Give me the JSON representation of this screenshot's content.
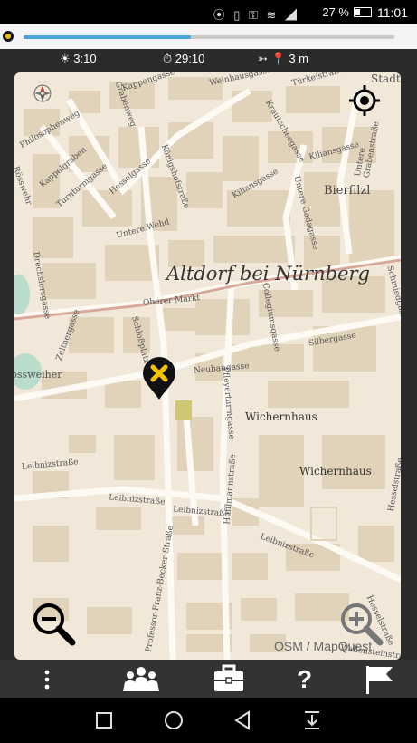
{
  "status_bar": {
    "icons": "⦿ ▯ ⚿ ≋ ◢",
    "battery_percent": "27 %",
    "time": "11:01"
  },
  "progress": {
    "fraction": 0.45
  },
  "info_bar": {
    "sunrise_time": "3:10",
    "timer": "29:10",
    "distance": "3 m"
  },
  "map": {
    "town_title": "Altdorf bei Nürnberg",
    "attribution": "OSM / MapQuest",
    "street_labels": {
      "kappengasse": "Kappengasse",
      "weinhausgasse": "Weinhausgasse",
      "turkeistrasse": "Türkeistraße",
      "stadt": "Stadt",
      "philosophenweg": "Philosophenweg",
      "grabenweg": "Grabenweg",
      "kappelgraben": "Kappelgraben",
      "turnturmgasse": "Turnturmgasse",
      "hesselgasse": "Hesselgasse",
      "koenigshofstrasse": "Königshofstraße",
      "krautscheegasse": "Krautscheegasse",
      "kiliansgasse_upper": "Kiliansgasse",
      "kiliansgasse_lower": "Kiliansgasse",
      "untere_grabenstrasse": "Untere Grabenstraße",
      "bierfilzl": "Bierfilzl",
      "untere_wehd": "Untere Wehd",
      "untere_gadagasse": "Untere Gadagasse",
      "rosswehr": "Rösswehr",
      "drechslersgasse": "Drechslersgasse",
      "oberer_markt": "Oberer Markt",
      "collegiumsgasse": "Collegiumsgasse",
      "schlosplatz": "Schloßplatz",
      "zeltnergasse": "Zeltnergasse",
      "silbergasse": "Silbergasse",
      "schmiedgasse": "Schmiedgasse",
      "rossweiher": "Rossweiher",
      "neubaugasse": "Neubaugasse",
      "pfleyerturmgasse": "Pfleyerturmgasse",
      "wichernhaus_1": "Wichernhaus",
      "wichernhaus_2": "Wichernhaus",
      "leibnizstrasse_1": "Leibnizstraße",
      "leibnizstrasse_2": "Leibnizstraße",
      "leibnizstrasse_3": "Leibnizstraße",
      "leibnizstrasse_4": "Leibnizstraße",
      "hesselstrasse": "Hesselstraße",
      "hesselstrasse_2": "Hesselstraße",
      "professor_franz_becker_strasse": "Professor-Franz-Becker-Straße",
      "hufflmannstrasse": "Hufflmannstraße",
      "wallensteinstrasse": "Wallensteinstraße"
    }
  },
  "colors": {
    "map_background": "#f1e8d9",
    "building": "#e1d2ba",
    "road": "#fdfaf3",
    "main_road": "#d7a99a",
    "accent_blue": "#4aa3df",
    "marker_yellow": "#f2c400",
    "bottom_bar": "#333333"
  },
  "bottom_bar": {
    "menu_icon": "more-vert-icon",
    "group_icon": "group-icon",
    "briefcase_icon": "briefcase-icon",
    "help_icon": "help-icon",
    "flag_icon": "flag-icon"
  }
}
